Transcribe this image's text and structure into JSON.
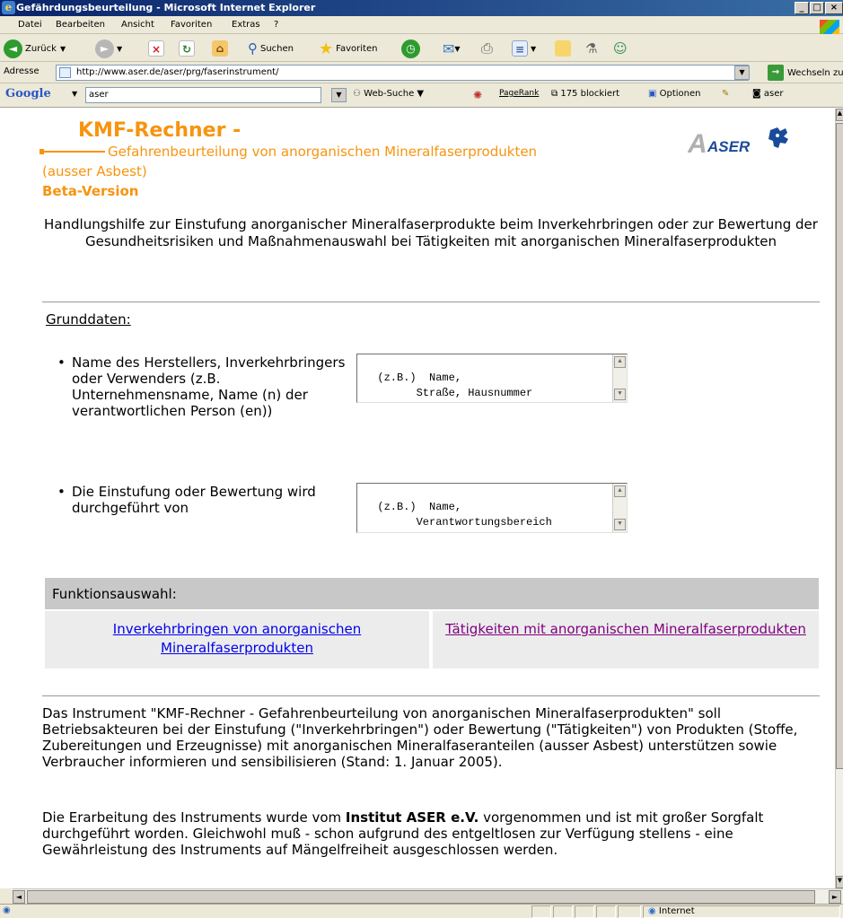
{
  "window": {
    "title": "Gefährdungsbeurteilung - Microsoft Internet Explorer"
  },
  "menu": [
    "Datei",
    "Bearbeiten",
    "Ansicht",
    "Favoriten",
    "Extras",
    "?"
  ],
  "toolbar": {
    "back": "Zurück",
    "search": "Suchen",
    "favorites": "Favoriten"
  },
  "address": {
    "label": "Adresse",
    "url": "http://www.aser.de/aser/prg/faserinstrument/",
    "go": "Wechseln zu"
  },
  "googlebar": {
    "logo": "Google",
    "query": "aser",
    "websearch": "Web-Suche",
    "pagerank": "PageRank",
    "blocked": "175 blockiert",
    "options": "Optionen",
    "aser_btn": "aser"
  },
  "page": {
    "title": "KMF-Rechner -",
    "subtitle1": "Gefahrenbeurteilung von anorganischen Mineralfaserprodukten",
    "subtitle2": "(ausser Asbest)",
    "beta": "Beta-Version",
    "logo_text": "ASER",
    "intro": "Handlungshilfe zur Einstufung anorganischer Mineralfaserprodukte beim Inverkehrbringen oder zur Bewertung der Gesundheitsrisiken und Maßnahmenauswahl bei Tätigkeiten mit anorganischen Mineralfaserprodukten",
    "grunddaten": "Grunddaten:",
    "field1": {
      "label": "Name des Herstellers, Inverkehrbringers oder Verwenders (z.B. Unternehmensname, Name (n) der verantwortlichen Person (en))",
      "value": "(z.B.)  Name,\n        Straße, Hausnummer\n        PLZ, Ort"
    },
    "field2": {
      "label": "Die Einstufung oder Bewertung wird durchgeführt von",
      "value": "(z.B.)  Name,\n        Verantwortungsbereich\n        etc."
    },
    "funktionsauswahl": "Funktionsauswahl:",
    "link_inverkehr": "Inverkehrbringen von anorganischen Mineralfaserprodukten",
    "link_taetigkeiten": "Tätigkeiten mit anorganischen Mineralfaserprodukten",
    "para1": "Das Instrument \"KMF-Rechner - Gefahrenbeurteilung von anorganischen Mineralfaserprodukten\" soll Betriebsakteuren bei der Einstufung (\"Inverkehrbringen\") oder Bewertung (\"Tätigkeiten\") von Produkten (Stoffe, Zubereitungen und Erzeugnisse) mit anorganischen Mineralfaseranteilen (ausser Asbest) unterstützen sowie Verbraucher informieren und sensibilisieren (Stand: 1. Januar 2005).",
    "para2_pre": "Die Erarbeitung des Instruments wurde vom ",
    "para2_bold": "Institut ASER e.V.",
    "para2_post": " vorgenommen und ist mit großer Sorgfalt durchgeführt worden. Gleichwohl muß - schon aufgrund des entgeltlosen zur Verfügung stellens - eine Gewährleistung des Instruments auf Mängelfreiheit ausgeschlossen werden."
  },
  "status": {
    "zone": "Internet"
  },
  "colors": {
    "orange": "#f7940f",
    "link": "#0000ee",
    "visited": "#800080"
  }
}
